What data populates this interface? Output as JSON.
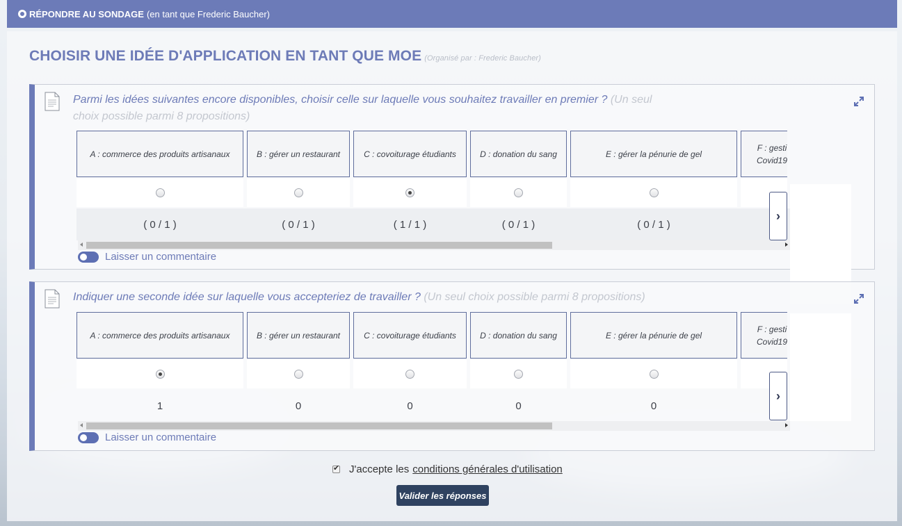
{
  "header": {
    "globe_icon": "globe-icon",
    "title": "RÉPONDRE AU SONDAGE",
    "subtitle": "(en tant que Frederic Baucher)"
  },
  "survey": {
    "title": "CHOISIR UNE IDÉE D'APPLICATION EN TANT QUE MOE",
    "organizer": "(Organisé par : Frederic Baucher)"
  },
  "questions": [
    {
      "text": "Parmi les idées suivantes encore disponibles, choisir celle sur laquelle vous souhaitez travailler en premier ?",
      "hint": "(Un seul choix possible parmi 8 propositions)",
      "options": [
        {
          "label": "A : commerce des produits artisanaux",
          "selected": false,
          "count": "( 0 / 1 )"
        },
        {
          "label": "B : gérer un restaurant",
          "selected": false,
          "count": "( 0 / 1 )"
        },
        {
          "label": "C : covoiturage étudiants",
          "selected": true,
          "count": "( 1 / 1 )"
        },
        {
          "label": "D : donation du sang",
          "selected": false,
          "count": "( 0 / 1 )"
        },
        {
          "label": "E : gérer la pénurie de gel",
          "selected": false,
          "count": "( 0 / 1 )"
        },
        {
          "label": "F : gesti\nCovid19",
          "selected": false,
          "count": ""
        }
      ],
      "comment_label": "Laisser un commentaire"
    },
    {
      "text": "Indiquer une seconde idée sur laquelle vous accepteriez de travailler ?",
      "hint": "(Un seul choix possible parmi 8 propositions)",
      "options": [
        {
          "label": "A : commerce des produits artisanaux",
          "selected": true,
          "count": "1"
        },
        {
          "label": "B : gérer un restaurant",
          "selected": false,
          "count": "0"
        },
        {
          "label": "C : covoiturage étudiants",
          "selected": false,
          "count": "0"
        },
        {
          "label": "D : donation du sang",
          "selected": false,
          "count": "0"
        },
        {
          "label": "E : gérer la pénurie de gel",
          "selected": false,
          "count": "0"
        },
        {
          "label": "F : gesti\nCovid19",
          "selected": false,
          "count": ""
        }
      ],
      "comment_label": "Laisser un commentaire"
    }
  ],
  "footer": {
    "accept_checked": true,
    "accept_prefix": "J'accepte les",
    "accept_link": "conditions générales d'utilisation",
    "submit_label": "Valider les réponses"
  },
  "colors": {
    "accent": "#6c7bb8",
    "submit": "#2f4260"
  }
}
